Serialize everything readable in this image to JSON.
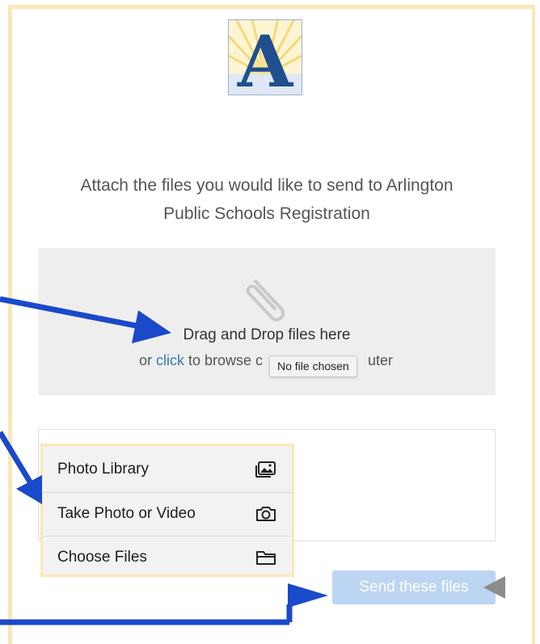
{
  "logo": {
    "letter": "A"
  },
  "intro": {
    "line1": "Attach the files you would like to send to Arlington",
    "line2": "Public Schools Registration"
  },
  "dropzone": {
    "headline": "Drag and Drop files here",
    "browse_prefix": "or ",
    "browse_link": "click",
    "browse_suffix": " to browse c",
    "browse_tail": "uter",
    "tooltip": "No file chosen"
  },
  "picker_menu": {
    "items": [
      {
        "label": "Photo Library",
        "icon": "photo-library-icon"
      },
      {
        "label": "Take Photo or Video",
        "icon": "camera-icon"
      },
      {
        "label": "Choose Files",
        "icon": "folder-icon"
      }
    ]
  },
  "send_button": {
    "label": "Send these files"
  },
  "colors": {
    "frame_border": "#fbe7b8",
    "arrow": "#1a49c9",
    "send_button_bg": "#bcd5f2",
    "link": "#3a78b8",
    "logo_blue": "#1f4f8f",
    "logo_gold": "#f4d670"
  }
}
